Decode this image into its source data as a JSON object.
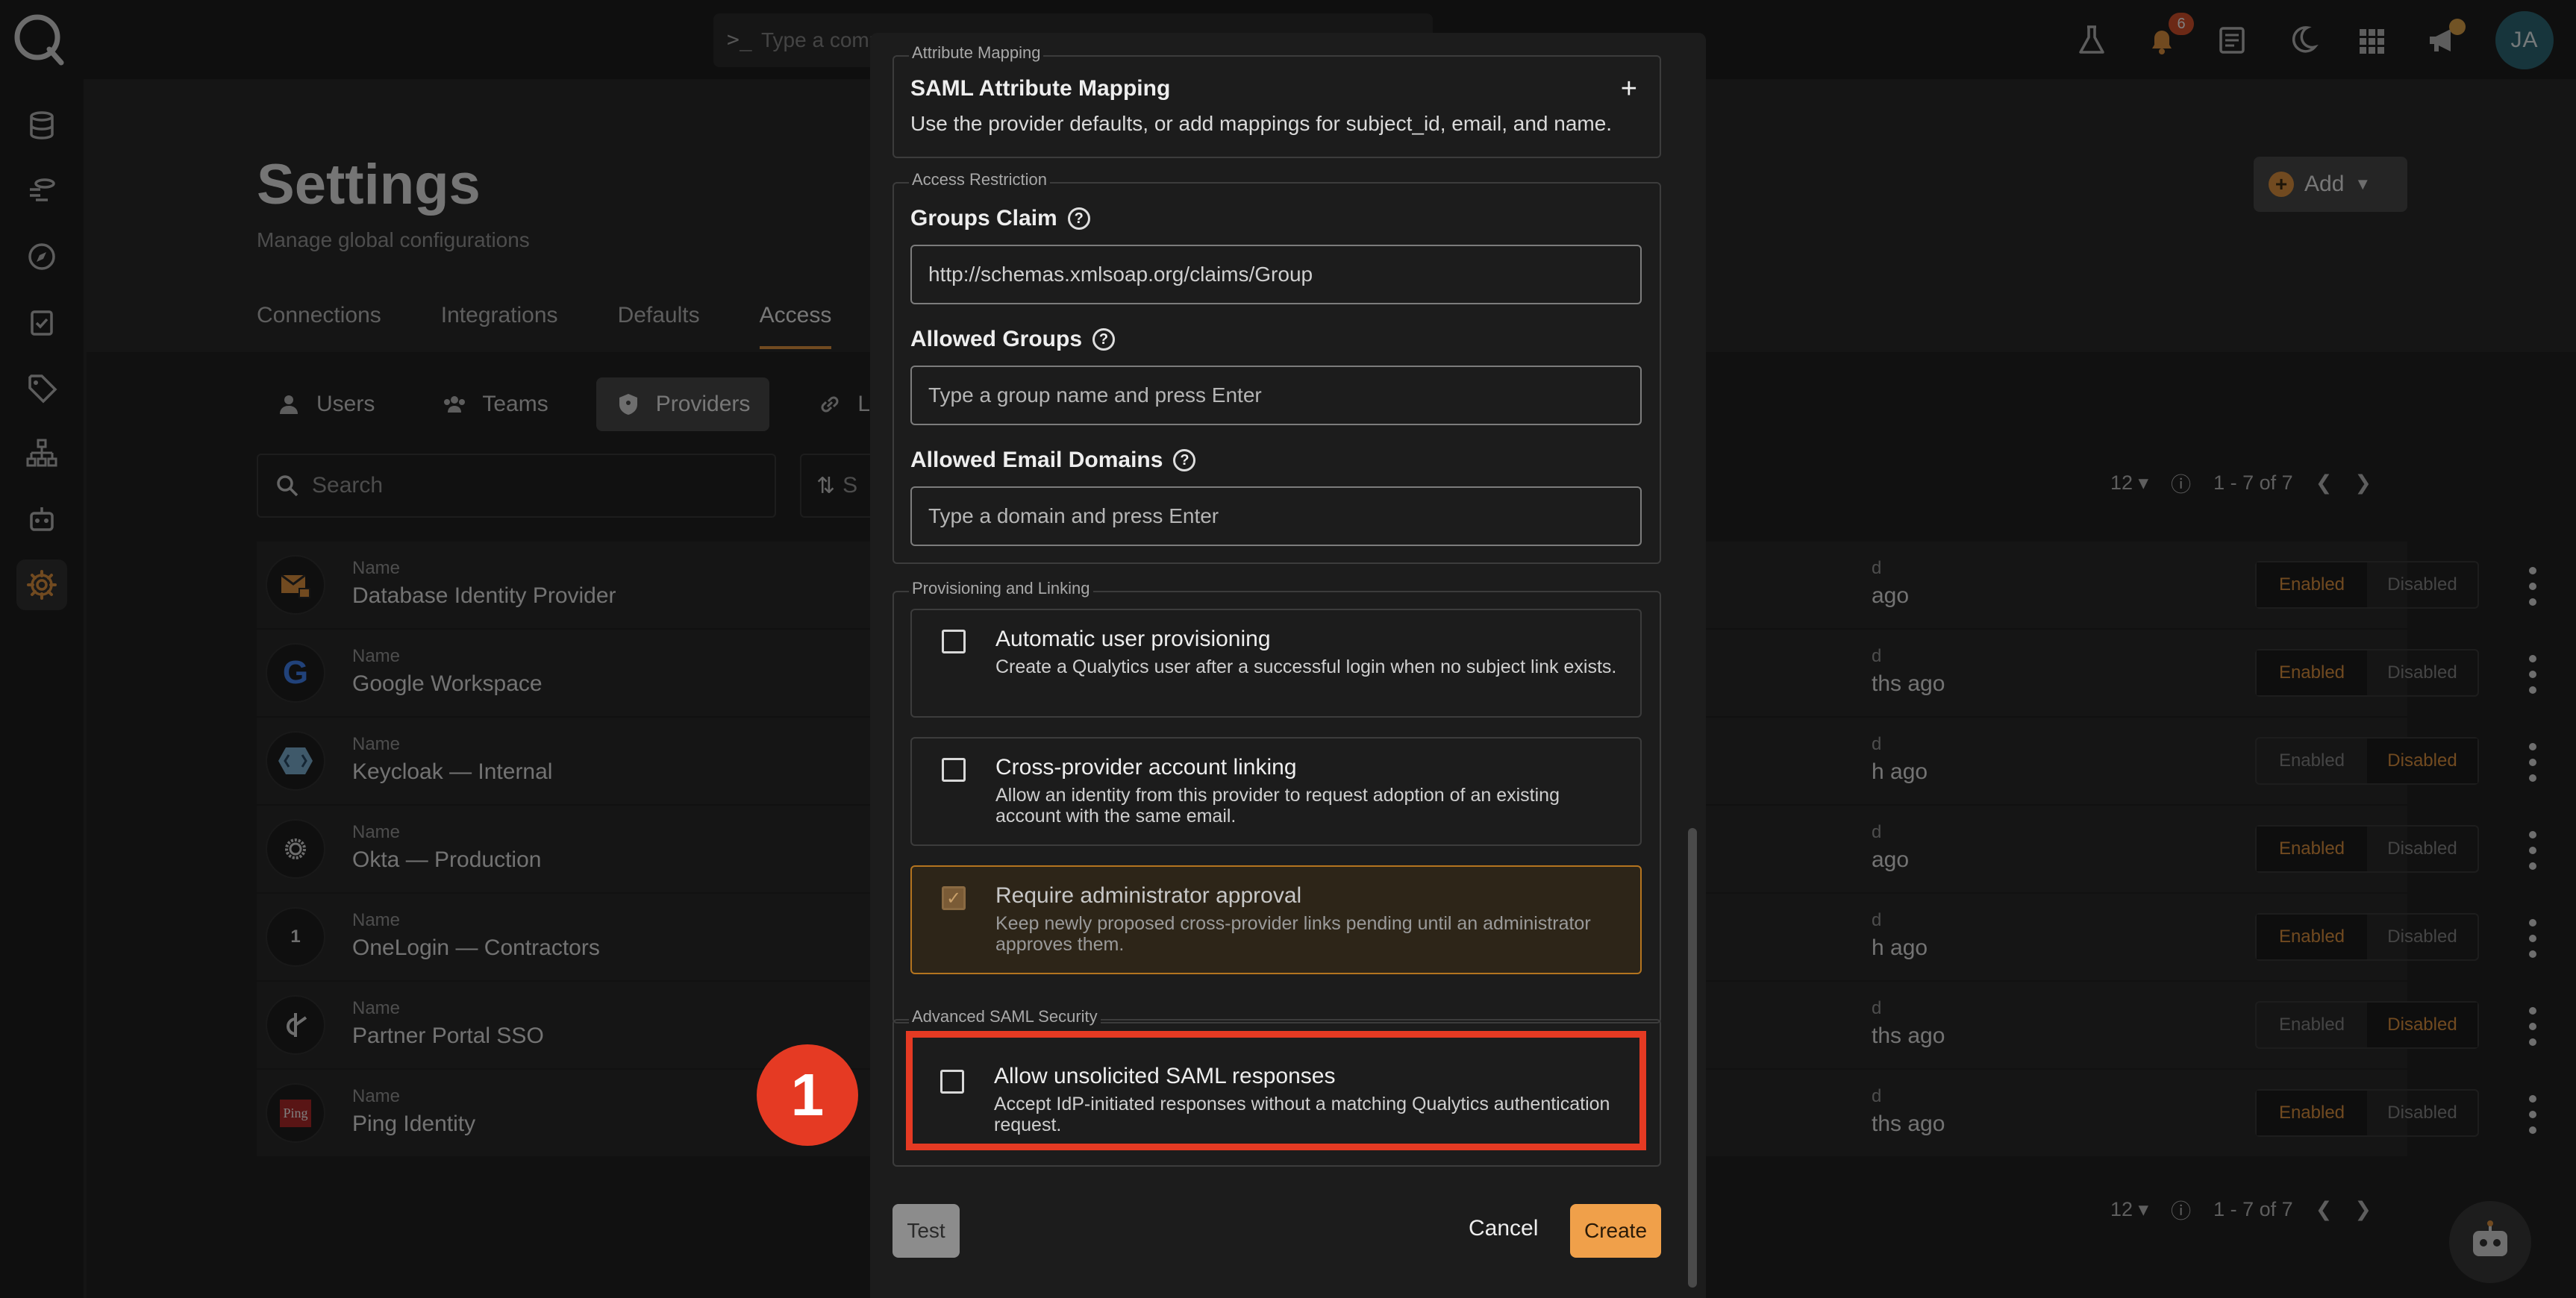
{
  "command_bar": {
    "placeholder": "Type a comm"
  },
  "topbar": {
    "notification_count": "6",
    "avatar_initials": "JA"
  },
  "page": {
    "title": "Settings",
    "subtitle": "Manage global configurations",
    "add_label": "Add",
    "tabs": [
      "Connections",
      "Integrations",
      "Defaults",
      "Access"
    ],
    "subtabs": [
      "Users",
      "Teams",
      "Providers",
      "Link"
    ],
    "search_placeholder": "Search",
    "sort_label": "S",
    "pager": {
      "page_size": "12",
      "range": "1 - 7 of 7"
    }
  },
  "providers": [
    {
      "label": "Name",
      "name": "Database Identity Provider",
      "ago": "ago",
      "status": "Enabled"
    },
    {
      "label": "Name",
      "name": "Google Workspace",
      "ago": "ths ago",
      "status": "Enabled"
    },
    {
      "label": "Name",
      "name": "Keycloak — Internal",
      "ago": "h ago",
      "status": "Disabled"
    },
    {
      "label": "Name",
      "name": "Okta — Production",
      "ago": "ago",
      "status": "Enabled"
    },
    {
      "label": "Name",
      "name": "OneLogin — Contractors",
      "ago": "h ago",
      "status": "Enabled"
    },
    {
      "label": "Name",
      "name": "Partner Portal SSO",
      "ago": "ths ago",
      "status": "Disabled"
    },
    {
      "label": "Name",
      "name": "Ping Identity",
      "ago": "ths ago",
      "status": "Enabled"
    }
  ],
  "provider_ago_label": "d",
  "seg_labels": {
    "enabled": "Enabled",
    "disabled": "Disabled"
  },
  "provider_logos": {
    "onelogin": "1",
    "ping": "Ping"
  },
  "modal": {
    "attribute_mapping": {
      "legend": "Attribute Mapping",
      "title": "SAML Attribute Mapping",
      "description": "Use the provider defaults, or add mappings for subject_id, email, and name.",
      "add_symbol": "+"
    },
    "access_restriction": {
      "legend": "Access Restriction",
      "groups_claim_label": "Groups Claim",
      "groups_claim_value": "http://schemas.xmlsoap.org/claims/Group",
      "allowed_groups_label": "Allowed Groups",
      "allowed_groups_placeholder": "Type a group name and press Enter",
      "allowed_domains_label": "Allowed Email Domains",
      "allowed_domains_placeholder": "Type a domain and press Enter"
    },
    "provisioning": {
      "legend": "Provisioning and Linking",
      "options": [
        {
          "title": "Automatic user provisioning",
          "description": "Create a Qualytics user after a successful login when no subject link exists.",
          "checked": false
        },
        {
          "title": "Cross-provider account linking",
          "description": "Allow an identity from this provider to request adoption of an existing account with the same email.",
          "checked": false
        },
        {
          "title": "Require administrator approval",
          "description": "Keep newly proposed cross-provider links pending until an administrator approves them.",
          "checked": true
        }
      ]
    },
    "advanced": {
      "legend": "Advanced SAML Security",
      "title": "Allow unsolicited SAML responses",
      "description": "Accept IdP-initiated responses without a matching Qualytics authentication request.",
      "checked": false
    },
    "footer": {
      "test": "Test",
      "cancel": "Cancel",
      "create": "Create"
    }
  },
  "annotation": {
    "step": "1"
  },
  "colors": {
    "accent": "#e39440",
    "highlight_border": "#e53a23",
    "background": "#222222"
  }
}
